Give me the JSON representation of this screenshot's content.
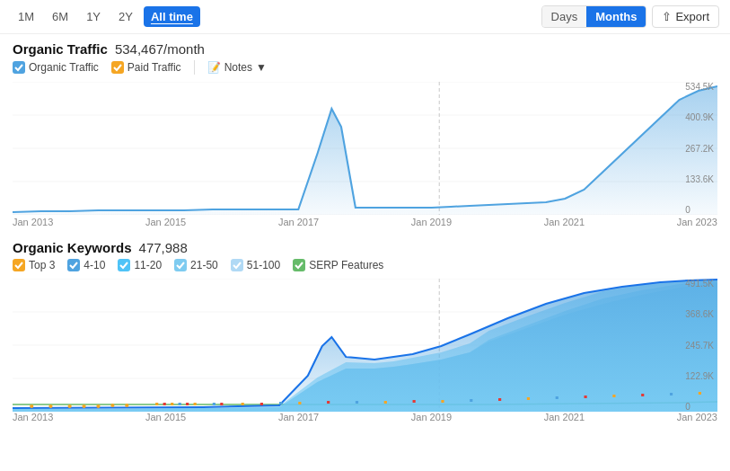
{
  "nav": {
    "filters": [
      "1M",
      "6M",
      "1Y",
      "2Y",
      "All time"
    ],
    "active_filter": "All time",
    "toggle": {
      "days_label": "Days",
      "months_label": "Months",
      "active": "Months"
    },
    "export_label": "Export"
  },
  "organic_traffic": {
    "title": "Organic Traffic",
    "value": "534,467/month",
    "legend": [
      {
        "id": "organic",
        "label": "Organic Traffic",
        "color": "#4fa3e0",
        "checked": true
      },
      {
        "id": "paid",
        "label": "Paid Traffic",
        "color": "#f5a623",
        "checked": true
      }
    ],
    "notes_label": "Notes",
    "y_labels": [
      "534.5K",
      "400.9K",
      "267.2K",
      "133.6K",
      "0"
    ],
    "x_labels": [
      "Jan 2013",
      "Jan 2015",
      "Jan 2017",
      "Jan 2019",
      "Jan 2021",
      "Jan 2023"
    ]
  },
  "organic_keywords": {
    "title": "Organic Keywords",
    "value": "477,988",
    "legend": [
      {
        "id": "top3",
        "label": "Top 3",
        "color": "#f5a623",
        "checked": true
      },
      {
        "id": "4-10",
        "label": "4-10",
        "color": "#4fa3e0",
        "checked": true
      },
      {
        "id": "11-20",
        "label": "11-20",
        "color": "#4fc3f7",
        "checked": true
      },
      {
        "id": "21-50",
        "label": "21-50",
        "color": "#7ecbf0",
        "checked": true
      },
      {
        "id": "51-100",
        "label": "51-100",
        "color": "#b0d9f5",
        "checked": true
      },
      {
        "id": "serp",
        "label": "SERP Features",
        "color": "#66bb6a",
        "checked": true
      }
    ],
    "y_labels": [
      "491.5K",
      "368.6K",
      "245.7K",
      "122.9K",
      "0"
    ],
    "x_labels": [
      "Jan 2013",
      "Jan 2015",
      "Jan 2017",
      "Jan 2019",
      "Jan 2021",
      "Jan 2023"
    ]
  }
}
